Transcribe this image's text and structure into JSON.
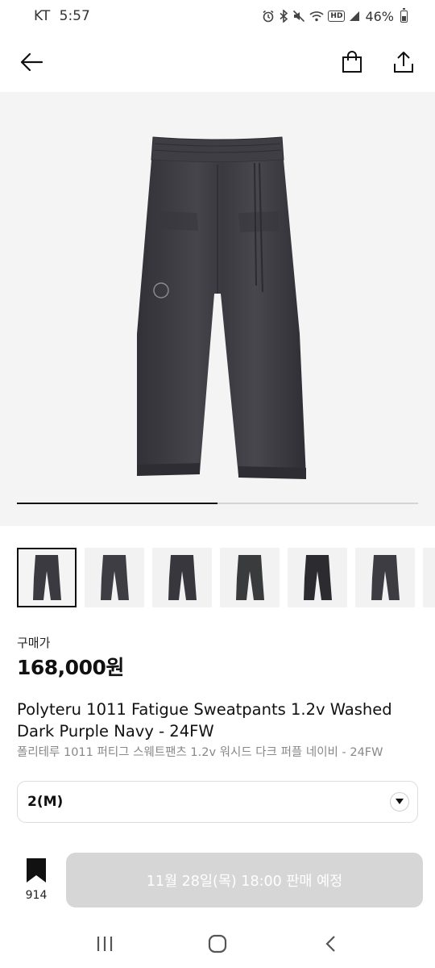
{
  "status_bar": {
    "carrier": "KT",
    "time": "5:57",
    "hd_label": "HD",
    "battery": "46%"
  },
  "header": {
    "icons": [
      "back-arrow-icon",
      "shopping-bag-icon",
      "share-icon"
    ]
  },
  "gallery": {
    "progress_fraction": 0.5,
    "thumbnail_count": 7,
    "selected_index": 0
  },
  "product": {
    "price_label": "구매가",
    "price": "168,000원",
    "name_en": "Polyteru 1011 Fatigue Sweatpants 1.2v Washed Dark Purple Navy - 24FW",
    "name_ko": "폴리테루 1011 퍼티그 스웨트팬츠 1.2v 워시드 다크 퍼플 네이비 - 24FW"
  },
  "size_select": {
    "value": "2(M)"
  },
  "bottom_bar": {
    "bookmark_count": "914",
    "release_button_label": "11월 28일(목) 18:00 판매 예정"
  },
  "colors": {
    "pants": "#3b3a40",
    "hero_bg": "#f4f4f4",
    "button_disabled": "#d6d6d6"
  }
}
